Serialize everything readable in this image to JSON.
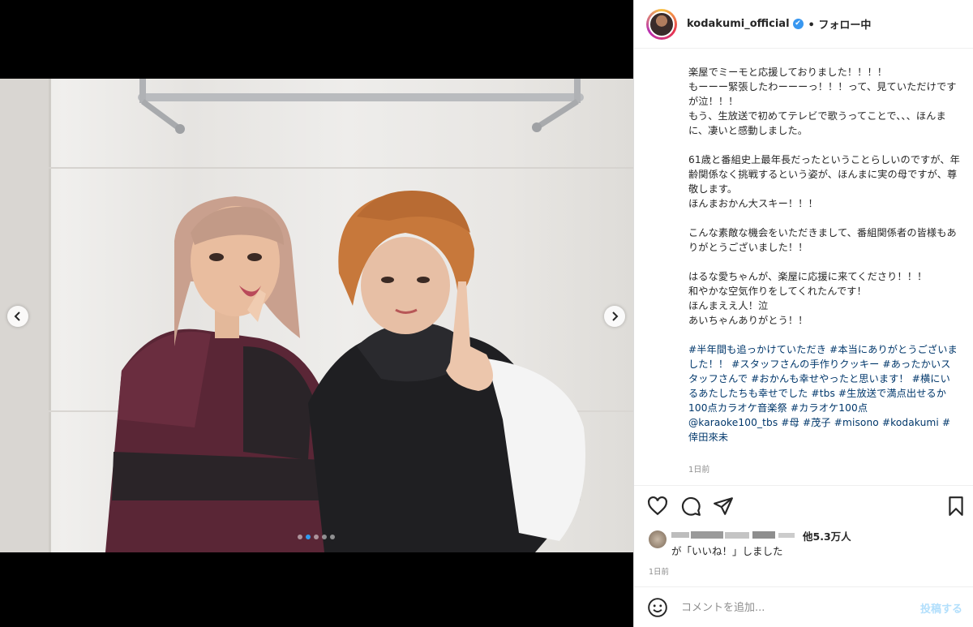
{
  "post": {
    "username": "kodakumi_official",
    "verified_badge": "✔",
    "follow_status": "• フォロー中",
    "caption_body": "楽屋でミーモと応援しておりました！！！！\nもーーー緊張したわーーーっ！！！って、見ていただけですが泣！！！\nもう、生放送で初めてテレビで歌うってことで、、、ほんまに、凄いと感動しました。\n\n61歳と番組史上最年長だったということらしいのですが、年齢関係なく挑戦するという姿が、ほんまに実の母ですが、尊敬します。\nほんまおかん大スキー！！！\n\nこんな素敵な機会をいただきまして、番組関係者の皆様もありがとうございました！！\n\nはるな愛ちゃんが、楽屋に応援に来てくださり！！！\n和やかな空気作りをしてくれたんです！\nほんまええ人！泣\nあいちゃんありがとう！！\n\n",
    "caption_tags": "#半年間も追っかけていただき #本当にありがとうございました！！ #スタッフさんの手作りクッキー #あったかいスタッフさんで #おかんも幸せやったと思います！ #横にいるあたしたちも幸せでした #tbs #生放送で満点出せるか100点カラオケ音楽祭 #カラオケ100点 @karaoke100_tbs #母 #茂子 #misono #kodakumi #倖田來未",
    "caption_time": "1日前",
    "likes_count": "他5.3万人",
    "likes_suffix": "が「いいね！」しました",
    "post_time": "1日前",
    "comment_placeholder": "コメントを追加...",
    "post_button": "投稿する"
  },
  "carousel": {
    "total_slides": 5,
    "active_slide": 2
  },
  "icons": {
    "like": "heart-icon",
    "comment": "comment-icon",
    "share": "share-icon",
    "save": "bookmark-icon",
    "emoji": "emoji-icon",
    "prev": "chevron-left-icon",
    "next": "chevron-right-icon"
  },
  "colors": {
    "link": "#00376b",
    "verified": "#3897f0",
    "carousel_active": "#2f9bf0",
    "post_button_disabled": "#b2dffc"
  }
}
